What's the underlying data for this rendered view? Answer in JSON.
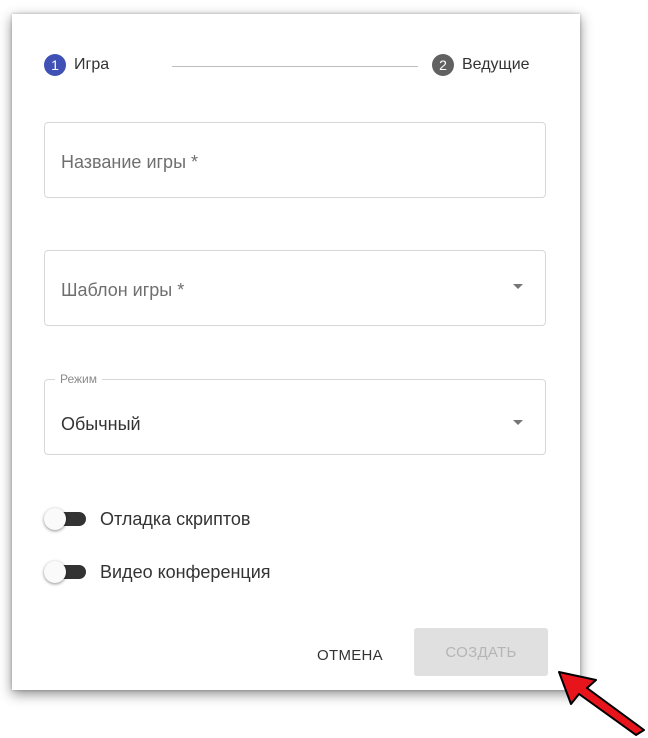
{
  "stepper": {
    "steps": [
      {
        "number": "1",
        "label": "Игра",
        "state": "active"
      },
      {
        "number": "2",
        "label": "Ведущие",
        "state": "inactive"
      }
    ]
  },
  "form": {
    "game_name": {
      "placeholder": "Название игры *"
    },
    "game_template": {
      "placeholder": "Шаблон игры *"
    },
    "mode": {
      "legend": "Режим",
      "value": "Обычный"
    }
  },
  "toggles": [
    {
      "label": "Отладка скриптов",
      "checked": false
    },
    {
      "label": "Видео конференция",
      "checked": false
    }
  ],
  "actions": {
    "cancel_label": "ОТМЕНА",
    "create_label": "СОЗДАТЬ"
  },
  "colors": {
    "accent": "#3f51b5",
    "annotation_arrow": "#e8141c"
  }
}
